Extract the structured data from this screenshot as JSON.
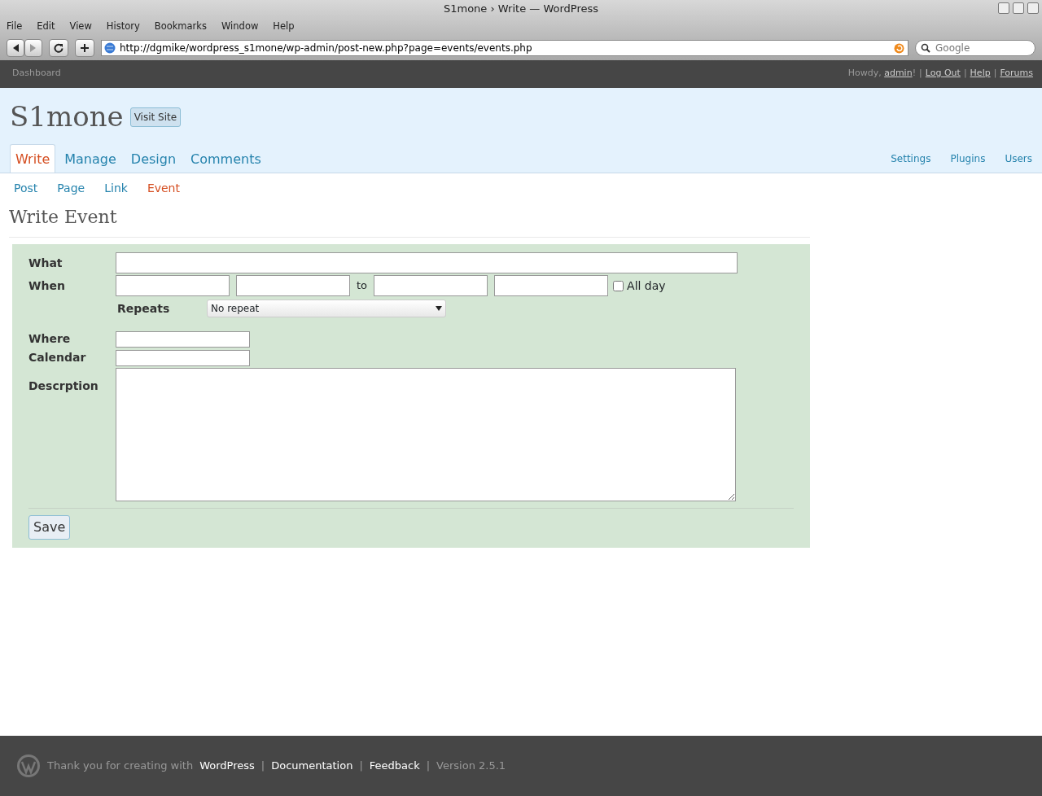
{
  "window": {
    "title": "S1mone › Write — WordPress"
  },
  "menu": [
    "File",
    "Edit",
    "View",
    "History",
    "Bookmarks",
    "Window",
    "Help"
  ],
  "toolbar": {
    "url": "http://dgmike/wordpress_s1mone/wp-admin/post-new.php?page=events/events.php",
    "search_placeholder": "Google"
  },
  "admin_bar": {
    "dashboard": "Dashboard",
    "greeting": {
      "before": "Howdy, ",
      "user": "admin",
      "after": "!"
    },
    "separator": "|",
    "links": [
      "Log Out",
      "Help",
      "Forums"
    ]
  },
  "site": {
    "title": "S1mone",
    "visit_button": "Visit Site"
  },
  "main_tabs": [
    {
      "label": "Write",
      "selected": true
    },
    {
      "label": "Manage",
      "selected": false
    },
    {
      "label": "Design",
      "selected": false
    },
    {
      "label": "Comments",
      "selected": false
    }
  ],
  "side_links": [
    "Settings",
    "Plugins",
    "Users"
  ],
  "sub_tabs": [
    {
      "label": "Post",
      "selected": false
    },
    {
      "label": "Page",
      "selected": false
    },
    {
      "label": "Link",
      "selected": false
    },
    {
      "label": "Event",
      "selected": true
    }
  ],
  "heading": "Write Event",
  "form": {
    "what": {
      "label": "What"
    },
    "when": {
      "label": "When",
      "to": "to",
      "all_day": {
        "label": "All day",
        "checked": false
      }
    },
    "repeats": {
      "label": "Repeats",
      "value": "No repeat"
    },
    "where": {
      "label": "Where"
    },
    "calendar": {
      "label": "Calendar"
    },
    "description": {
      "label": "Descrption"
    },
    "save": "Save"
  },
  "footer": {
    "thanks": "Thank you for creating with",
    "links": [
      "WordPress",
      "Documentation",
      "Feedback"
    ],
    "separator": "|",
    "version": "Version 2.5.1"
  }
}
